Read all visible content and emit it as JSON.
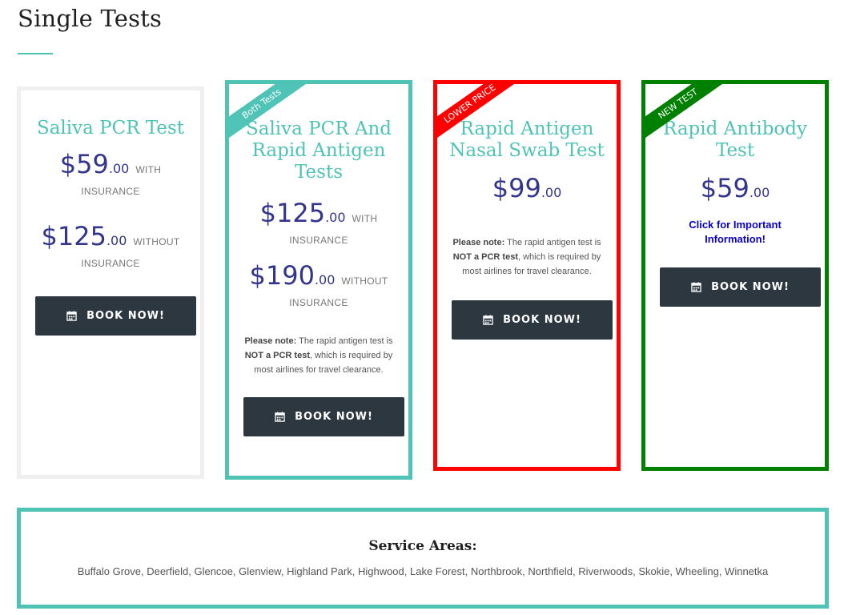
{
  "section": {
    "title": "Single Tests"
  },
  "colors": {
    "accent": "#4ec3b6",
    "price": "#33348e",
    "button": "#2d3740",
    "red": "#ff0000",
    "green": "#008000",
    "link": "#0a00c8"
  },
  "cards": [
    {
      "title": "Saliva PCR Test",
      "prices": [
        {
          "dollars": "$59",
          "cents": ".00",
          "suffix": "WITH",
          "line2": "INSURANCE"
        },
        {
          "dollars": "$125",
          "cents": ".00",
          "suffix": "WITHOUT",
          "line2": "INSURANCE"
        }
      ],
      "button_label": "BOOK NOW!"
    },
    {
      "ribbon": "Both Tests",
      "title": "Saliva PCR And Rapid Antigen Tests",
      "prices": [
        {
          "dollars": "$125",
          "cents": ".00",
          "suffix": "WITH",
          "line2": "INSURANCE"
        },
        {
          "dollars": "$190",
          "cents": ".00",
          "suffix": "WITHOUT",
          "line2": "INSURANCE"
        }
      ],
      "note": {
        "lead": "Please note:",
        "text1": " The rapid antigen test is ",
        "bold": "NOT a PCR test",
        "text2": ", which is required by most airlines for travel clearance."
      },
      "button_label": "BOOK NOW!"
    },
    {
      "ribbon": "LOWER PRICE",
      "title": "Rapid Antigen Nasal Swab Test",
      "prices": [
        {
          "dollars": "$99",
          "cents": ".00"
        }
      ],
      "note": {
        "lead": "Please note:",
        "text1": " The rapid antigen test is ",
        "bold": "NOT a PCR test",
        "text2": ", which is required by most airlines for travel clearance."
      },
      "button_label": "BOOK NOW!"
    },
    {
      "ribbon": "NEW TEST",
      "title": "Rapid Antibody Test",
      "prices": [
        {
          "dollars": "$59",
          "cents": ".00"
        }
      ],
      "link": "Click for Important Information!",
      "button_label": "BOOK NOW!"
    }
  ],
  "service_areas": {
    "title": "Service Areas:",
    "list": "Buffalo Grove, Deerfield, Glencoe, Glenview, Highland Park, Highwood, Lake Forest, Northbrook, Northfield, Riverwoods, Skokie, Wheeling, Winnetka"
  },
  "icons": {
    "book": "calendar-icon"
  }
}
